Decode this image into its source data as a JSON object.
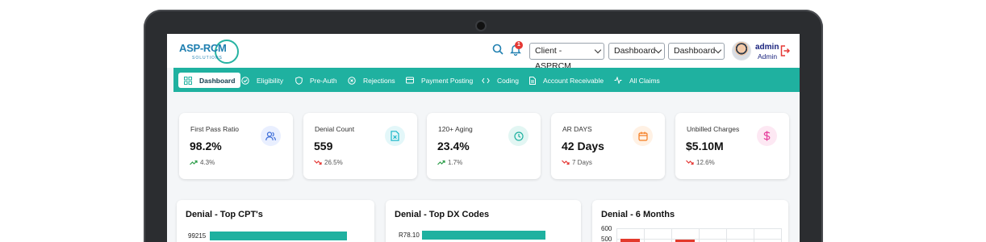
{
  "app": {
    "logo_text": "ASP-RCM",
    "logo_sub": "SOLUTIONS"
  },
  "header": {
    "notification_count": "1",
    "client_select": "Client - ASPRCM",
    "dashboard_select_1": "Dashboard",
    "dashboard_select_2": "Dashboard",
    "user_name": "admin",
    "user_role": "Admin"
  },
  "nav": {
    "items": [
      {
        "label": "Dashboard",
        "icon": "grid-icon"
      },
      {
        "label": "Eligibility",
        "icon": "check-circle-icon"
      },
      {
        "label": "Pre-Auth",
        "icon": "shield-icon"
      },
      {
        "label": "Rejections",
        "icon": "x-circle-icon"
      },
      {
        "label": "Payment Posting",
        "icon": "credit-card-icon"
      },
      {
        "label": "Coding",
        "icon": "code-icon"
      },
      {
        "label": "Account Receivable",
        "icon": "document-icon"
      },
      {
        "label": "All Claims",
        "icon": "activity-icon"
      }
    ]
  },
  "cards": [
    {
      "title": "First Pass Ratio",
      "value": "98.2%",
      "trend": "4.3%",
      "direction": "up",
      "icon": "users-icon",
      "color": "#3f6fd8",
      "bg": "#e9efff"
    },
    {
      "title": "Denial Count",
      "value": "559",
      "trend": "26.5%",
      "direction": "down",
      "icon": "file-x-icon",
      "color": "#19b6c8",
      "bg": "#e3f7f9"
    },
    {
      "title": "120+ Aging",
      "value": "23.4%",
      "trend": "1.7%",
      "direction": "up",
      "icon": "clock-icon",
      "color": "#1fb1a0",
      "bg": "#e2f6f3"
    },
    {
      "title": "AR DAYS",
      "value": "42 Days",
      "trend": "7 Days",
      "direction": "down",
      "icon": "calendar-icon",
      "color": "#f57c1f",
      "bg": "#fff1e4"
    },
    {
      "title": "Unbilled Charges",
      "value": "$5.10M",
      "trend": "12.6%",
      "direction": "down",
      "icon": "dollar-icon",
      "color": "#e5399a",
      "bg": "#fde8f3"
    }
  ],
  "panels": {
    "cpt": {
      "title": "Denial - Top CPT's",
      "bar_label": "99215"
    },
    "dx": {
      "title": "Denial - Top DX Codes",
      "bar_label": "R78.10"
    },
    "months": {
      "title": "Denial - 6 Months",
      "y_ticks": [
        "600",
        "500"
      ]
    }
  },
  "colors": {
    "accent": "#1fb1a0",
    "up": "#2e9e4a",
    "down": "#e53935",
    "bar_red": "#e33a2c"
  }
}
